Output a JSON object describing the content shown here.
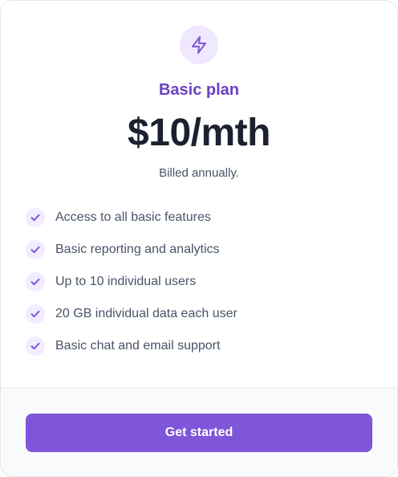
{
  "plan": {
    "icon": "lightning-bolt-icon",
    "name": "Basic plan",
    "price": "$10/mth",
    "billing": "Billed annually."
  },
  "features": [
    {
      "icon": "check-icon",
      "label": "Access to all basic features"
    },
    {
      "icon": "check-icon",
      "label": "Basic reporting and analytics"
    },
    {
      "icon": "check-icon",
      "label": "Up to 10 individual users"
    },
    {
      "icon": "check-icon",
      "label": "20 GB individual data each user"
    },
    {
      "icon": "check-icon",
      "label": "Basic chat and email support"
    }
  ],
  "cta": {
    "label": "Get started"
  },
  "colors": {
    "accent": "#7f56d9",
    "accent_dark": "#6941c6",
    "accent_soft": "#f0e8ff",
    "text_primary": "#1b2130",
    "text_secondary": "#475467",
    "footer_bg": "#f9fafb",
    "border": "#e4e7ec"
  }
}
